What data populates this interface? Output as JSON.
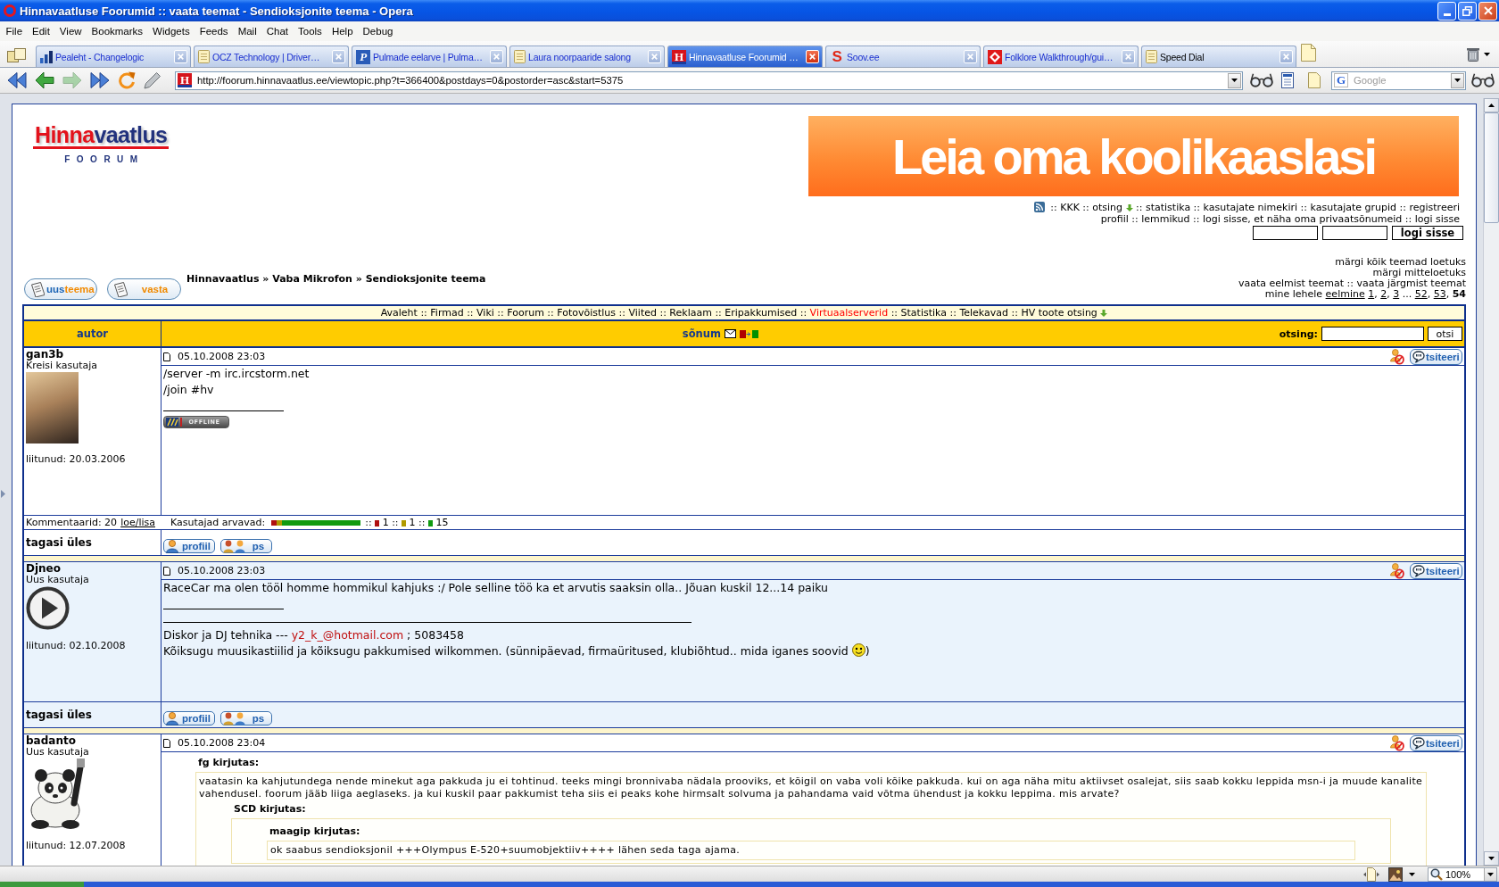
{
  "window": {
    "title": "Hinnavaatluse Foorumid :: vaata teemat - Sendioksjonite teema - Opera"
  },
  "menu": [
    "File",
    "Edit",
    "View",
    "Bookmarks",
    "Widgets",
    "Feeds",
    "Mail",
    "Chat",
    "Tools",
    "Help",
    "Debug"
  ],
  "tabs": [
    {
      "label": "Pealeht - Changelogic",
      "kind": "page",
      "selected": false
    },
    {
      "label": "OCZ Technology | Driver…",
      "kind": "page",
      "selected": false
    },
    {
      "label": "Pulmade eelarve | Pulma…",
      "kind": "page",
      "icon_text": "P",
      "selected": false
    },
    {
      "label": "Laura noorpaaride salong",
      "kind": "page",
      "selected": false
    },
    {
      "label": "Hinnavaatluse Foorumid …",
      "kind": "page",
      "icon_text": "H",
      "selected": true
    },
    {
      "label": "Soov.ee",
      "kind": "page",
      "icon_text": "S",
      "selected": false
    },
    {
      "label": "Folklore Walkthrough/gui…",
      "kind": "page",
      "selected": false
    },
    {
      "label": "Speed Dial",
      "kind": "speed_dial",
      "selected": false
    }
  ],
  "nav_buttons": [
    {
      "disabled": false
    },
    {
      "disabled": false
    },
    {
      "disabled": true
    },
    {
      "disabled": false
    },
    {
      "disabled": false
    },
    {
      "disabled": false
    }
  ],
  "address_bar": {
    "icon_text": "H",
    "url": "http://foorum.hinnavaatlus.ee/viewtopic.php?t=366400&postdays=0&postorder=asc&start=5375"
  },
  "search_field": {
    "icon_text": "G",
    "placeholder": "Google"
  },
  "logo": {
    "parts": [
      {
        "text": "Hinna",
        "color": "#e3121b"
      },
      {
        "text": "vaatlus",
        "color": "#22327d"
      }
    ],
    "subtitle": "FOORUM"
  },
  "banner": {
    "text": "Leia oma koolikaaslasi"
  },
  "user_links": [
    [
      {
        "sep": "::",
        "label": "KKK",
        "arrow": false
      },
      {
        "sep": "::",
        "label": "otsing",
        "arrow": true
      },
      {
        "sep": "::",
        "label": "statistika",
        "arrow": false
      },
      {
        "sep": "::",
        "label": "kasutajate nimekiri",
        "arrow": false
      },
      {
        "sep": "::",
        "label": "kasutajate grupid",
        "arrow": false
      },
      {
        "sep": "::",
        "label": "registreeri",
        "arrow": false
      }
    ],
    [
      {
        "label": "profiil",
        "arrow": false
      },
      {
        "sep": "::",
        "label": "lemmikud",
        "arrow": false
      },
      {
        "sep": "::",
        "label": "logi sisse, et näha oma privaatsõnumeid",
        "arrow": false
      },
      {
        "sep": "::",
        "label": "logi sisse",
        "arrow": false
      }
    ]
  ],
  "login": {
    "button": "logi sisse"
  },
  "topic_buttons": {
    "new_topic": [
      {
        "text": "uus",
        "color": "#1a63b4"
      },
      {
        "text": "teema",
        "color": "#f28a00"
      }
    ],
    "reply": "vasta"
  },
  "breadcrumbs": [
    {
      "label": "Hinnavaatlus",
      "after": "»"
    },
    {
      "label": "Vaba Mikrofon",
      "after": "»"
    },
    {
      "label": "Sendioksjonite teema"
    }
  ],
  "topic_links": [
    [
      {
        "label": "märgi kõik teemad loetuks"
      }
    ],
    [
      {
        "label": "märgi mitteloetuks"
      }
    ],
    [
      {
        "label": "vaata eelmist teemat"
      },
      {
        "sep": "::",
        "label": "vaata järgmist teemat"
      }
    ]
  ],
  "pagination": {
    "label": "mine lehele",
    "previous": "eelmine",
    "pages": [
      {
        "label": "1",
        "after": ",",
        "selected": false
      },
      {
        "label": "2",
        "after": ",",
        "selected": false
      },
      {
        "label": "3",
        "after": " ...",
        "selected": false
      },
      {
        "label": "52",
        "after": ",",
        "selected": false
      },
      {
        "label": "53",
        "after": ",",
        "selected": false
      },
      {
        "label": "54",
        "selected": true
      }
    ]
  },
  "site_nav": [
    {
      "label": "Avaleht",
      "highlighted": false,
      "arrow": false
    },
    {
      "sep": "::",
      "label": "Firmad",
      "highlighted": false,
      "arrow": false
    },
    {
      "sep": "::",
      "label": "Viki",
      "highlighted": false,
      "arrow": false
    },
    {
      "sep": "::",
      "label": "Foorum",
      "highlighted": false,
      "arrow": false
    },
    {
      "sep": "::",
      "label": "Fotovõistlus",
      "highlighted": false,
      "arrow": false
    },
    {
      "sep": "::",
      "label": "Viited",
      "highlighted": false,
      "arrow": false
    },
    {
      "sep": "::",
      "label": "Reklaam",
      "highlighted": false,
      "arrow": false
    },
    {
      "sep": "::",
      "label": "Eripakkumised",
      "highlighted": false,
      "arrow": false
    },
    {
      "sep": "::",
      "label": "Virtuaalserverid",
      "highlighted": true,
      "arrow": false
    },
    {
      "sep": "::",
      "label": "Statistika",
      "highlighted": false,
      "arrow": false
    },
    {
      "sep": "::",
      "label": "Telekavad",
      "highlighted": false,
      "arrow": false
    },
    {
      "sep": "::",
      "label": "HV toote otsing",
      "highlighted": false,
      "arrow": true
    }
  ],
  "table_header": {
    "author": "autor",
    "message": "sõnum",
    "search_label": "otsing:",
    "search_button": "otsi"
  },
  "posts": [
    {
      "author": "gan3b",
      "rank": "Kreisi kasutaja",
      "avatar": {
        "kind": "photo"
      },
      "joined": "liitunud: 20.03.2006",
      "shaded": false,
      "date": "05.10.2008 23:03",
      "quote_button": "tsiteeri",
      "body": [
        "/server -m irc.ircstorm.net",
        "/join #hv"
      ],
      "signature": [
        {
          "kind": "badge",
          "text": "OFFLINE"
        }
      ],
      "comments": {
        "text": "Kommentaarid: 20",
        "link": "loe/lisa",
        "rating_label": "Kasutajad arvavad:",
        "ratings": [
          {
            "sep": "::",
            "color": "#b01010",
            "count": "1"
          },
          {
            "sep": "::",
            "color": "#b09a00",
            "count": "1"
          },
          {
            "sep": "::",
            "color": "#109a10",
            "count": "15"
          }
        ]
      },
      "footer": {
        "label": "tagasi üles",
        "buttons": [
          {
            "kind": "profile",
            "label": "profiil"
          },
          {
            "kind": "message",
            "label": "ps"
          }
        ]
      }
    },
    {
      "author": "Djneo",
      "rank": "Uus kasutaja",
      "avatar": {
        "kind": "play"
      },
      "joined": "liitunud: 02.10.2008",
      "shaded": true,
      "date": "05.10.2008 23:03",
      "quote_button": "tsiteeri",
      "body": [
        "RaceCar ma olen tööl homme hommikul kahjuks :/ Pole selline töö ka et arvutis saaksin olla.. Jõuan kuskil 12...14 paiku"
      ],
      "signature": [
        {
          "kind": "rule"
        },
        {
          "kind": "text",
          "text": "Diskor ja DJ tehnika --- ",
          "link": "y2_k_@hotmail.com",
          "tail": " ; 5083458",
          "emoticon": false
        },
        {
          "kind": "text",
          "text": "Kõiksugu muusikastiilid ja kõiksugu pakkumised wilkommen. (sünnipäevad, firmaüritused, klubiõhtud.. mida iganes soovid",
          "emoticon": true,
          "tail": ")"
        }
      ],
      "footer": {
        "label": "tagasi üles",
        "buttons": [
          {
            "kind": "profile",
            "label": "profiil"
          },
          {
            "kind": "message",
            "label": "ps"
          }
        ]
      }
    },
    {
      "author": "badanto",
      "rank": "Uus kasutaja",
      "avatar": {
        "kind": "panda"
      },
      "joined": "liitunud: 12.07.2008",
      "shaded": false,
      "date": "05.10.2008 23:04",
      "quote_button": "tsiteeri",
      "quote": {
        "author": "fg kirjutas:",
        "text": "vaatasin ka kahjutundega nende minekut aga pakkuda ju ei tohtinud. teeks mingi bronnivaba nädala prooviks, et kõigil on vaba voli kõike pakkuda. kui on aga näha mitu aktiivset osalejat, siis saab kokku leppida msn-i ja muude kanalite vahendusel. foorum jääb liiga aeglaseks. ja kui kuskil paar pakkumist teha siis ei peaks kohe hirmsalt solvuma ja pahandama vaid võtma ühendust ja kokku leppima. mis arvate?",
        "quote": {
          "author": "SCD kirjutas:",
          "quote": {
            "author": "maagip kirjutas:",
            "text": "ok saabus sendioksjonil +++Olympus E-520+suumobjektiiv++++ lähen seda taga ajama."
          }
        }
      }
    }
  ],
  "status_bar": {
    "zoom": "100%"
  }
}
